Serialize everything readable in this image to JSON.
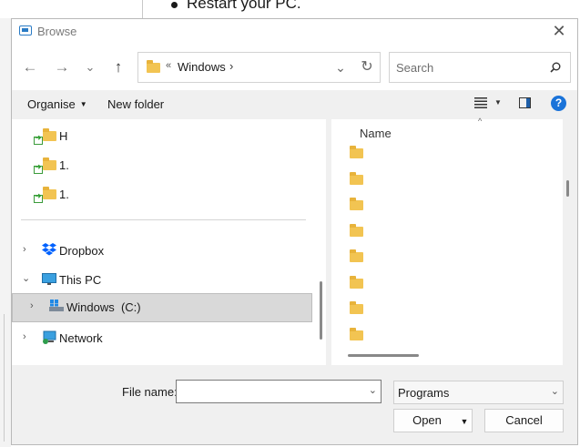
{
  "background": {
    "bullet_text": "Restart your PC."
  },
  "dialog": {
    "title": "Browse",
    "close_glyph": "✕",
    "nav": {
      "back": "←",
      "forward": "→",
      "recent": "⌄",
      "up": "↑"
    },
    "address": {
      "chevron": "«",
      "path": "Windows",
      "separator": "›",
      "dropdown": "⌄",
      "refresh": "↻"
    },
    "search": {
      "placeholder": "Search"
    },
    "toolbar": {
      "organise": "Organise",
      "new_folder": "New folder",
      "help": "?"
    },
    "nav_pane": {
      "shared_items": [
        "H",
        "1.",
        "1."
      ],
      "locations": [
        {
          "label": "Dropbox",
          "expander": "›",
          "icon": "dropbox-icon"
        },
        {
          "label": "This PC",
          "expander": "⌄",
          "icon": "monitor-icon"
        },
        {
          "label": "Windows  (C:)",
          "expander": "›",
          "icon": "drive-icon",
          "selected": true
        },
        {
          "label": "Network",
          "expander": "›",
          "icon": "network-icon"
        }
      ]
    },
    "file_pane": {
      "column_header": "Name",
      "sort_caret": "^",
      "folder_count": 8
    },
    "footer": {
      "file_name_label": "File name:",
      "file_name_value": "",
      "file_type": "Programs",
      "open_label": "Open",
      "cancel_label": "Cancel"
    }
  },
  "colors": {
    "accent": "#1a73d9",
    "folder": "#f2c452",
    "selection": "#d9d9d9"
  }
}
